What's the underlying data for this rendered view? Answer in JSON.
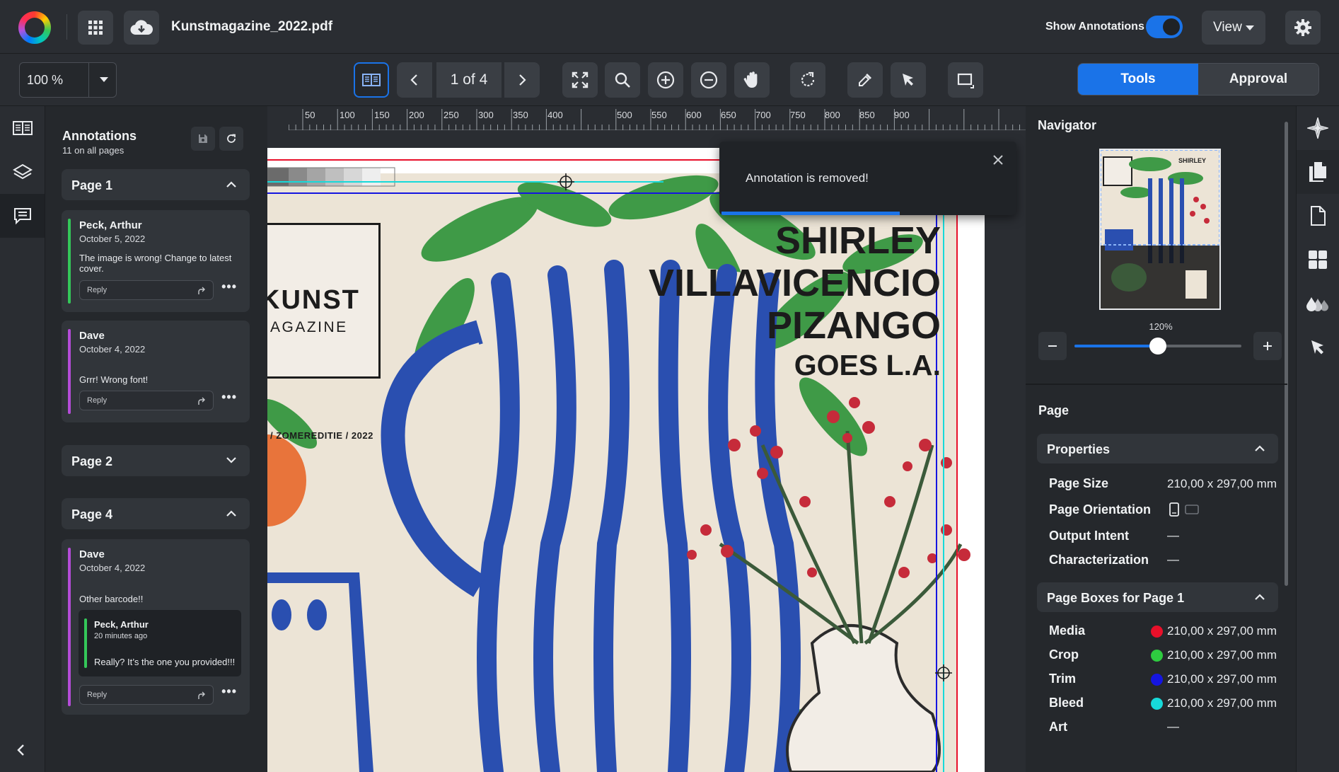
{
  "header": {
    "file_name": "Kunstmagazine_2022.pdf",
    "show_annotations_label": "Show Annotations",
    "show_annotations_on": true,
    "view_label": "View"
  },
  "toolbar": {
    "zoom_value": "100 %",
    "page_indicator": "1 of 4",
    "mode_tabs": [
      {
        "label": "Tools",
        "active": true
      },
      {
        "label": "Approval",
        "active": false
      }
    ]
  },
  "ruler": {
    "labels": [
      "50",
      "100",
      "150",
      "200",
      "250",
      "300",
      "350",
      "400",
      "500",
      "550",
      "600",
      "650",
      "700",
      "750",
      "800",
      "850",
      "900"
    ]
  },
  "annotations": {
    "title": "Annotations",
    "subtitle": "11 on all pages",
    "reply_placeholder": "Reply",
    "page1": {
      "label": "Page 1",
      "comments": [
        {
          "author": "Peck, Arthur",
          "date": "October 5, 2022",
          "text": "The image is wrong! Change to latest cover.",
          "color": "#34c759"
        },
        {
          "author": "Dave",
          "date": "October 4, 2022",
          "text": "Grrr! Wrong font!",
          "color": "#b44cd8"
        }
      ]
    },
    "page2": {
      "label": "Page 2"
    },
    "page4": {
      "label": "Page 4",
      "comment": {
        "author": "Dave",
        "date": "October 4, 2022",
        "text": "Other barcode!!",
        "color": "#b44cd8",
        "reply": {
          "author": "Peck, Arthur",
          "date": "20 minutes ago",
          "text": "Really? It’s the one you provided!!!",
          "color": "#34c759"
        }
      }
    }
  },
  "cover": {
    "title_line1": "SHIRLEY",
    "title_line2": "VILLAVICENCIO",
    "title_line3": "PIZANGO",
    "title_line4": "GOES L.A.",
    "logo_word": "KUNST",
    "logo_sub": "AGAZINE",
    "edition": "/ ZOMEREDITIE / 2022"
  },
  "toast": {
    "message": "Annotation is removed!",
    "progress": 0.6
  },
  "navigator": {
    "title": "Navigator",
    "zoom_label": "120%",
    "zoom_fraction": 0.5
  },
  "page_panel": {
    "title": "Page",
    "properties": {
      "label": "Properties",
      "rows": [
        {
          "label": "Page Size",
          "value": "210,00 x 297,00 mm"
        },
        {
          "label": "Page Orientation",
          "value": ""
        },
        {
          "label": "Output Intent",
          "value": "—"
        },
        {
          "label": "Characterization",
          "value": "—"
        }
      ]
    },
    "page_boxes": {
      "label": "Page Boxes for Page 1",
      "rows": [
        {
          "label": "Media",
          "value": "210,00 x 297,00 mm",
          "color": "#e8102a"
        },
        {
          "label": "Crop",
          "value": "210,00 x 297,00 mm",
          "color": "#2ecc40"
        },
        {
          "label": "Trim",
          "value": "210,00 x 297,00 mm",
          "color": "#1515e0"
        },
        {
          "label": "Bleed",
          "value": "210,00 x 297,00 mm",
          "color": "#17d9d9"
        },
        {
          "label": "Art",
          "value": "—",
          "color": ""
        }
      ]
    }
  },
  "colors": {
    "accent": "#1a73e8",
    "panel": "#25282c",
    "surface": "#31353a"
  }
}
